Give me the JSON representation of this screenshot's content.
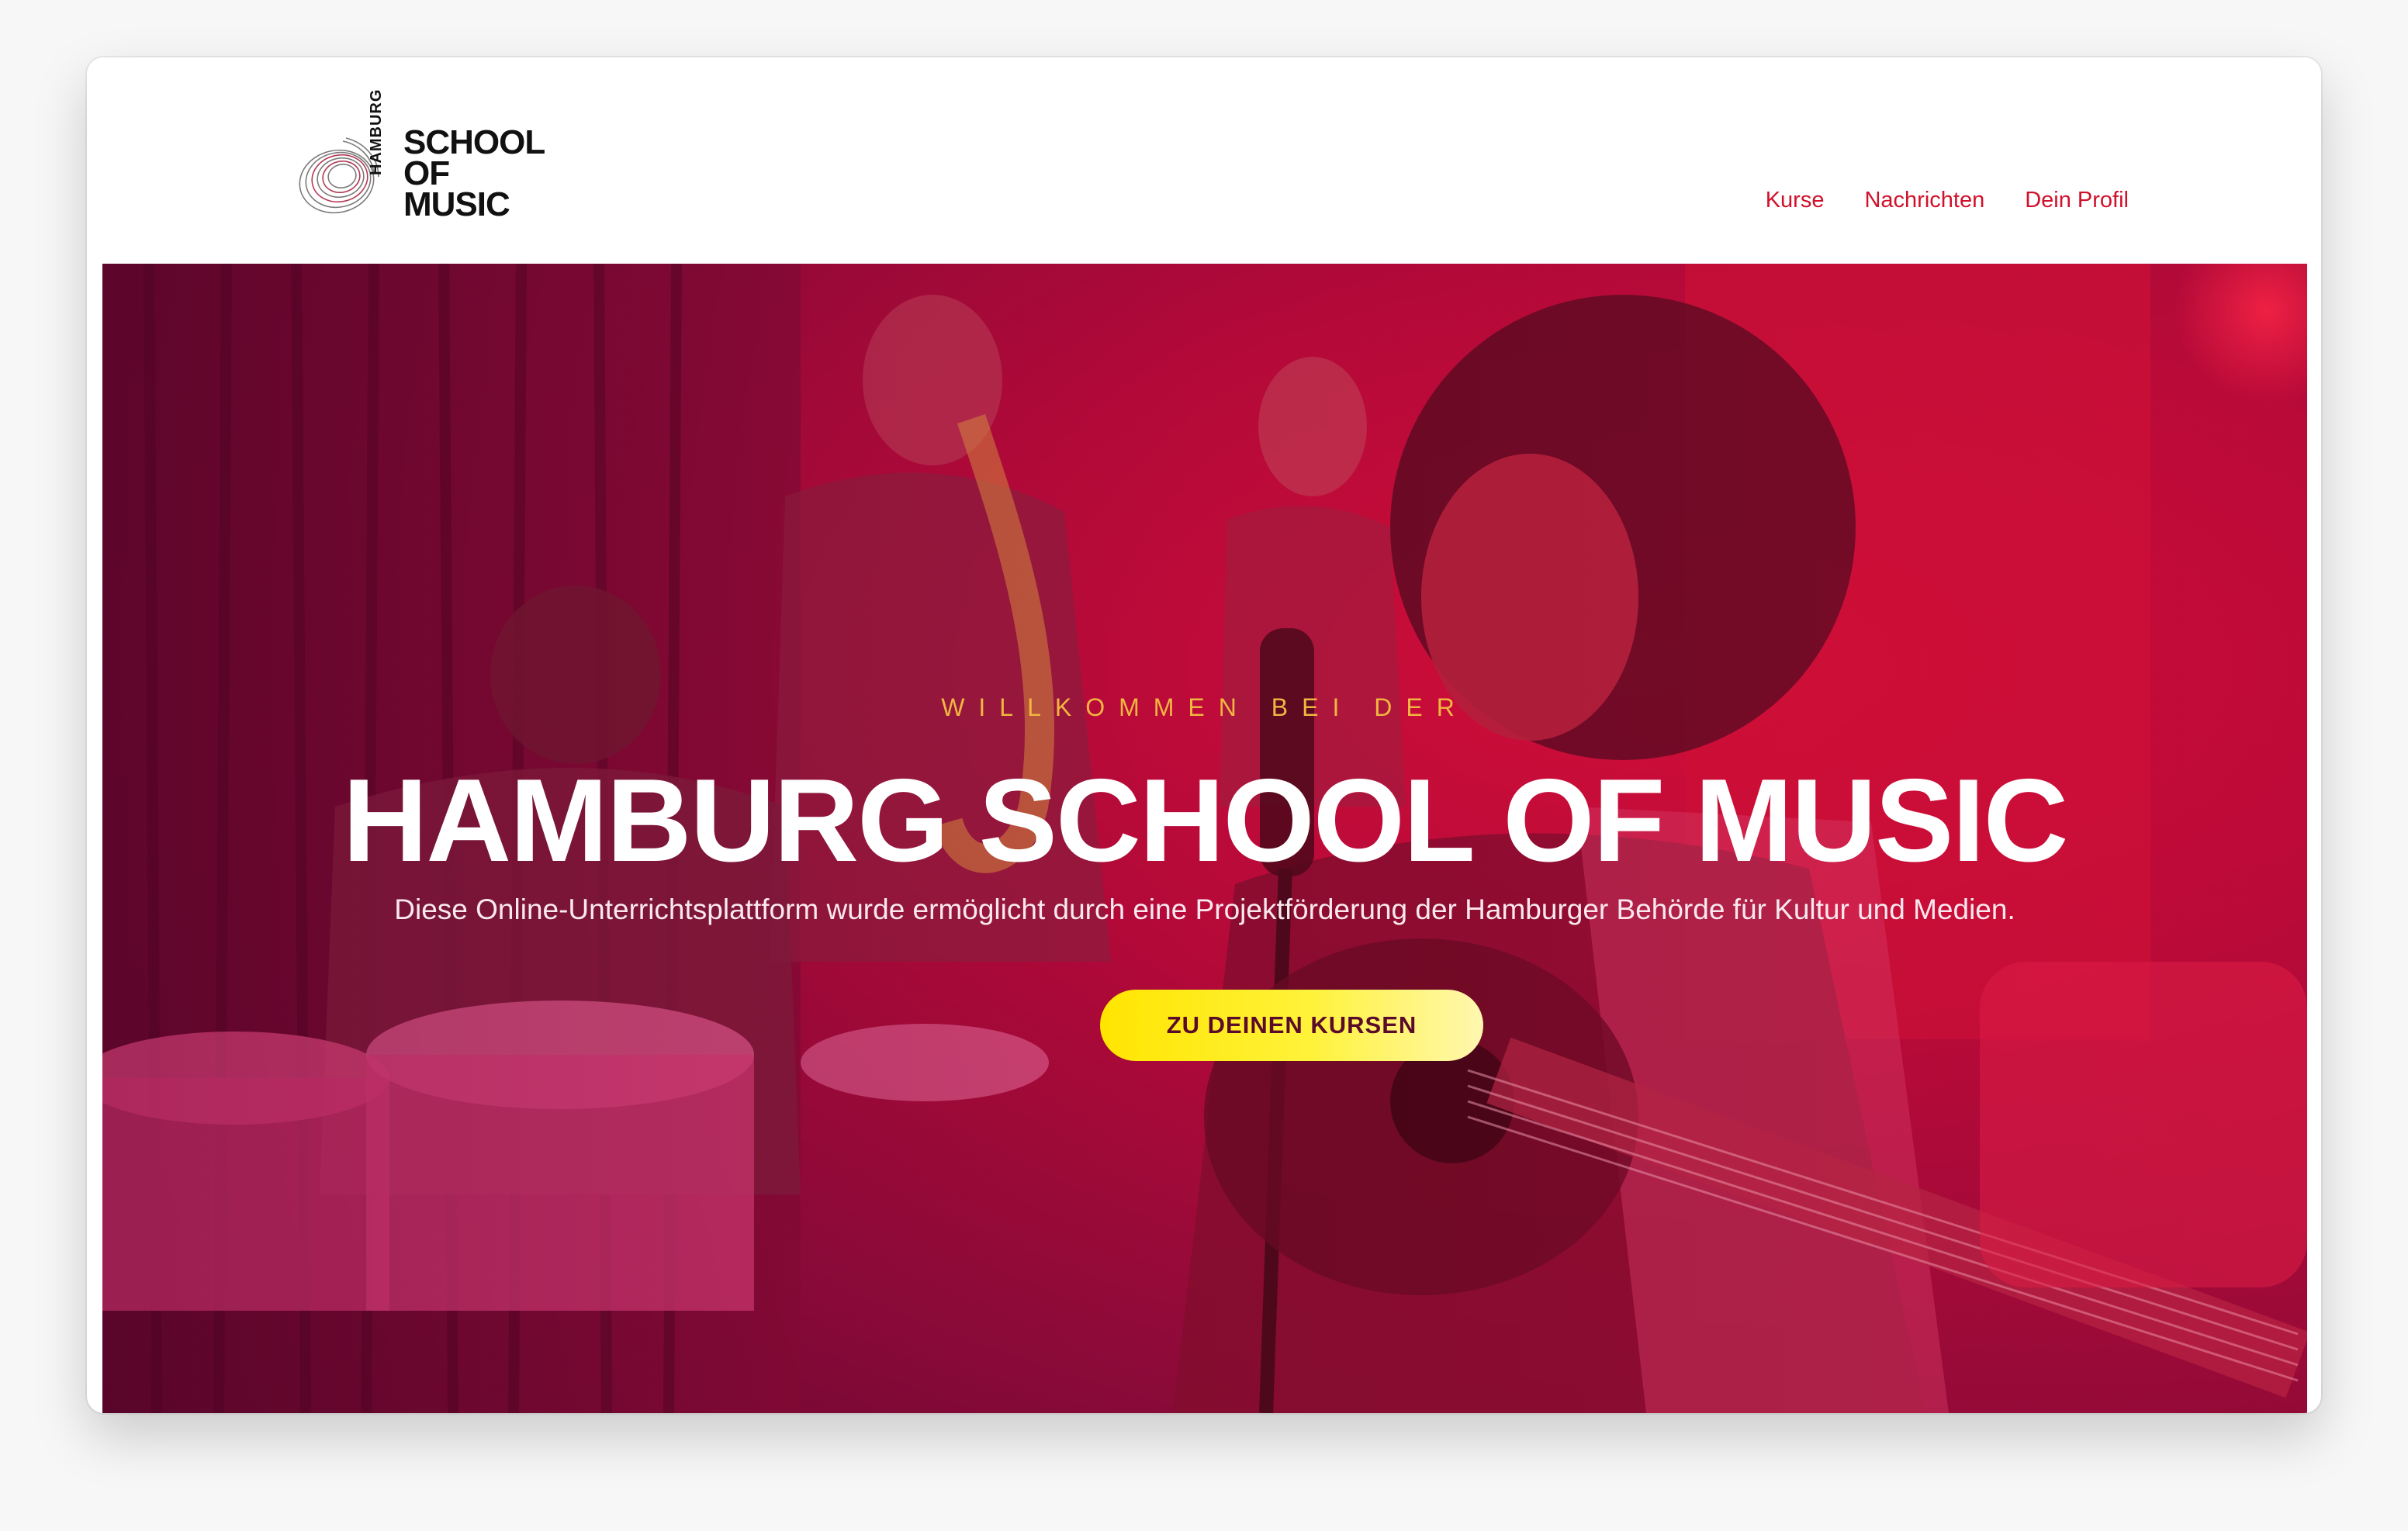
{
  "browser": {
    "icons": [
      "sidebar-toggle-icon",
      "chevron-down-icon",
      "back-icon",
      "download-icon",
      "share-icon",
      "new-tab-icon",
      "tab-overview-icon"
    ]
  },
  "site": {
    "logo": {
      "vertical_text": "HAMBURG",
      "line1": "SCHOOL",
      "line2": "OF",
      "line3": "MUSIC"
    },
    "nav": [
      {
        "label": "Kurse"
      },
      {
        "label": "Nachrichten"
      },
      {
        "label": "Dein Profil"
      }
    ]
  },
  "hero": {
    "kicker": "WILLKOMMEN BEI DER",
    "title": "HAMBURG SCHOOL OF MUSIC",
    "subtitle": "Diese Online-Unterrichtsplattform wurde ermöglicht durch eine Projektförderung der Hamburger Behörde für Kultur und Medien.",
    "cta_label": "ZU DEINEN KURSEN"
  },
  "colors": {
    "accent": "#d0112b",
    "hero_red": "#c40d3c",
    "cta_yellow": "#fff23a",
    "kicker_gold": "#f1b640"
  }
}
